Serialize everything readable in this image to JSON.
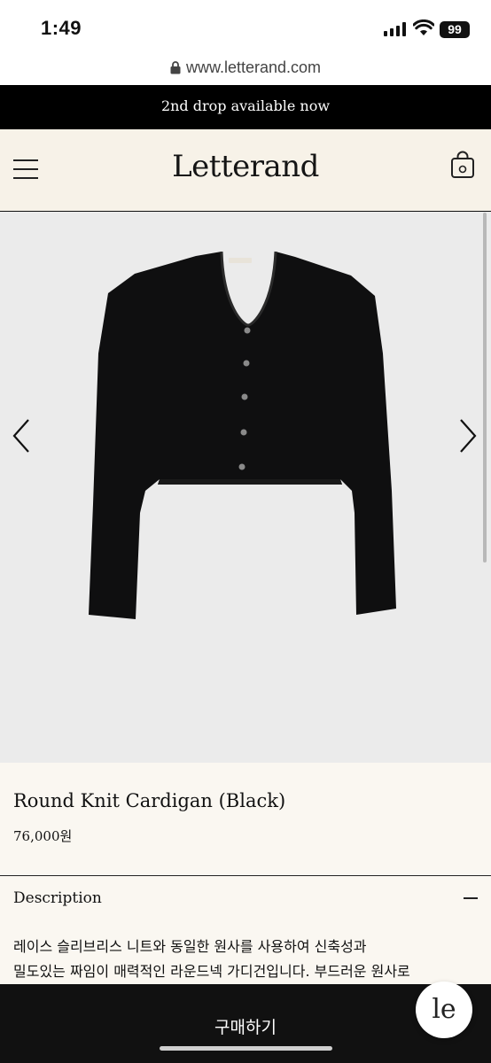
{
  "status_bar": {
    "time": "1:49",
    "battery": "99"
  },
  "browser": {
    "url": "www.letterand.com"
  },
  "announcement": {
    "text": "2nd drop available now"
  },
  "header": {
    "logo": "Letterand"
  },
  "product": {
    "name": "Round Knit Cardigan (Black)",
    "price": "76,000원",
    "description_label": "Description",
    "description_lines": [
      "레이스 슬리브리스 니트와 동일한 원사를 사용하여 신축성과",
      "밀도있는 짜임이 매력적인 라운드넥 가디건입니다. 부드러운 원사로"
    ]
  },
  "cta": {
    "label": "구매하기"
  },
  "chat": {
    "logo_text": "le"
  },
  "colors": {
    "accent": "#000000",
    "header_bg": "#f7f2e8",
    "image_bg": "#ebebeb"
  },
  "icons": [
    "lock-icon",
    "menu-icon",
    "bag-icon",
    "chevron-left-icon",
    "chevron-right-icon",
    "minus-icon"
  ]
}
